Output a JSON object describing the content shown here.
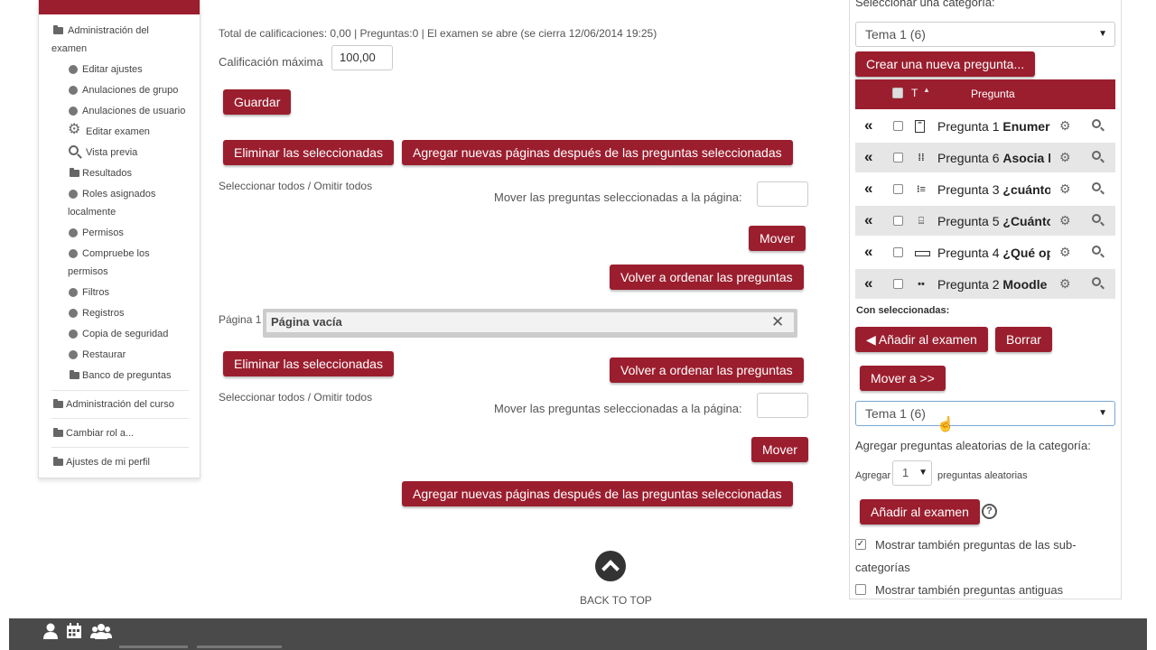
{
  "colors": {
    "accent": "#9b1e2e",
    "footer": "#4a4a4a"
  },
  "left_nav": {
    "exam_admin_line1": "Administración del",
    "exam_admin_line2": "examen",
    "items": [
      {
        "label": "Editar ajustes",
        "icon": "dot-icon"
      },
      {
        "label": "Anulaciones de grupo",
        "icon": "dot-icon"
      },
      {
        "label": "Anulaciones de usuario",
        "icon": "dot-icon"
      },
      {
        "label": "Editar examen",
        "icon": "gear-icon"
      },
      {
        "label": "Vista previa",
        "icon": "search-icon"
      },
      {
        "label": "Resultados",
        "icon": "folder-icon"
      },
      {
        "label": "Roles asignados",
        "label2": "localmente",
        "icon": "dot-icon"
      },
      {
        "label": "Permisos",
        "icon": "dot-icon"
      },
      {
        "label": "Compruebe los",
        "label2": "permisos",
        "icon": "dot-icon"
      },
      {
        "label": "Filtros",
        "icon": "dot-icon"
      },
      {
        "label": "Registros",
        "icon": "dot-icon"
      },
      {
        "label": "Copia de seguridad",
        "icon": "dot-icon"
      },
      {
        "label": "Restaurar",
        "icon": "dot-icon"
      },
      {
        "label": "Banco de preguntas",
        "icon": "folder-icon"
      }
    ],
    "course_admin": "Administración del curso",
    "switch_role": "Cambiar rol a...",
    "profile_settings": "Ajustes de mi perfil"
  },
  "main": {
    "summary": "Total de calificaciones: 0,00 | Preguntas:0 | El examen se abre (se cierra 12/06/2014 19:25)",
    "max_grade_label": "Calificación máxima",
    "max_grade_value": "100,00",
    "save_button": "Guardar",
    "delete_selected": "Eliminar las seleccionadas",
    "add_pages": "Agregar nuevas páginas después de las preguntas seleccionadas",
    "select_all": "Seleccionar todos / Omitir todos",
    "move_to_page_label": "Mover las preguntas seleccionadas a la página:",
    "move_button": "Mover",
    "reorder_button": "Volver a ordenar las preguntas",
    "page_label": "Página 1",
    "empty_page": "Página vacía",
    "back_to_top": "BACK TO TOP"
  },
  "right_panel": {
    "category_label": "Seleccionar una categoría:",
    "category_value": "Tema 1 (6)",
    "create_question": "Crear una nueva pregunta...",
    "table_header_type": "T",
    "table_header_question": "Pregunta",
    "questions": [
      {
        "name": "Pregunta 1",
        "bold": "Enumer",
        "icon": "essay-icon"
      },
      {
        "name": "Pregunta 6",
        "bold": "Asocia l",
        "icon": "matching-icon"
      },
      {
        "name": "Pregunta 3",
        "bold": "¿cuánto",
        "icon": "numerical-icon"
      },
      {
        "name": "Pregunta 5",
        "bold": "¿Cuánto",
        "icon": "calculated-icon"
      },
      {
        "name": "Pregunta 4",
        "bold": "¿Qué op",
        "icon": "shortanswer-icon"
      },
      {
        "name": "Pregunta 2",
        "bold": "Moodle",
        "icon": "truefalse-icon"
      }
    ],
    "with_selected": "Con seleccionadas:",
    "add_to_exam": "◀ Añadir al examen",
    "delete": "Borrar",
    "move_to": "Mover a >>",
    "move_category_value": "Tema 1 (6)",
    "random_label": "Agregar preguntas aleatorias de la categoría:",
    "add_word": "Agregar",
    "random_count": "1",
    "random_suffix": "preguntas aleatorias",
    "add_exam_button": "Añadir al examen",
    "show_subcats_line1": "Mostrar también preguntas de las sub-",
    "show_subcats_line2": "categorías",
    "show_subcats_checked": true,
    "show_old": "Mostrar también preguntas antiguas",
    "show_old_checked": false
  },
  "footer": {
    "icons": [
      "user-icon",
      "calendar-icon",
      "users-icon"
    ]
  }
}
